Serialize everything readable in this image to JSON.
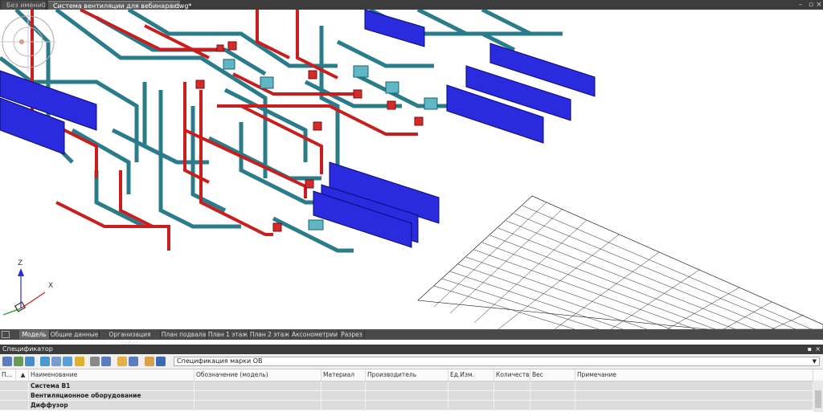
{
  "doc_tabs": [
    {
      "label": "Без имени0",
      "active": false
    },
    {
      "label": "Система вентиляции для вебинара.dwg*",
      "active": true
    }
  ],
  "layout_tabs": [
    "Модель",
    "Общие данные",
    "Организация работ",
    "План подвала",
    "План 1 этаж",
    "План 2 этаж",
    "Аксонометрии",
    "Разрез"
  ],
  "active_layout": "Модель",
  "axes": {
    "z": "Z",
    "x": "X"
  },
  "spec_panel": {
    "title": "Спецификатор",
    "selected_spec": "Спецификация марки ОВ",
    "columns": [
      "П...",
      "Наименование",
      "Обозначение (модель)",
      "Материал",
      "Производитель",
      "Ед.Изм.",
      "Количество",
      "Вес",
      "Примечание"
    ],
    "rows": [
      {
        "name": "Система В1"
      },
      {
        "name": "Вентиляционное оборудование"
      },
      {
        "name": "Диффузор"
      }
    ]
  },
  "colors": {
    "duct_cyan": "#2a8a9a",
    "fan_blue": "#2a2adf",
    "duct_red": "#c81e1e",
    "tab_bg": "#3c3c3c"
  },
  "icons": [
    "sort-icon",
    "filter-icon",
    "refresh-icon",
    "settings-icon",
    "print-icon",
    "export-icon",
    "search-icon"
  ]
}
